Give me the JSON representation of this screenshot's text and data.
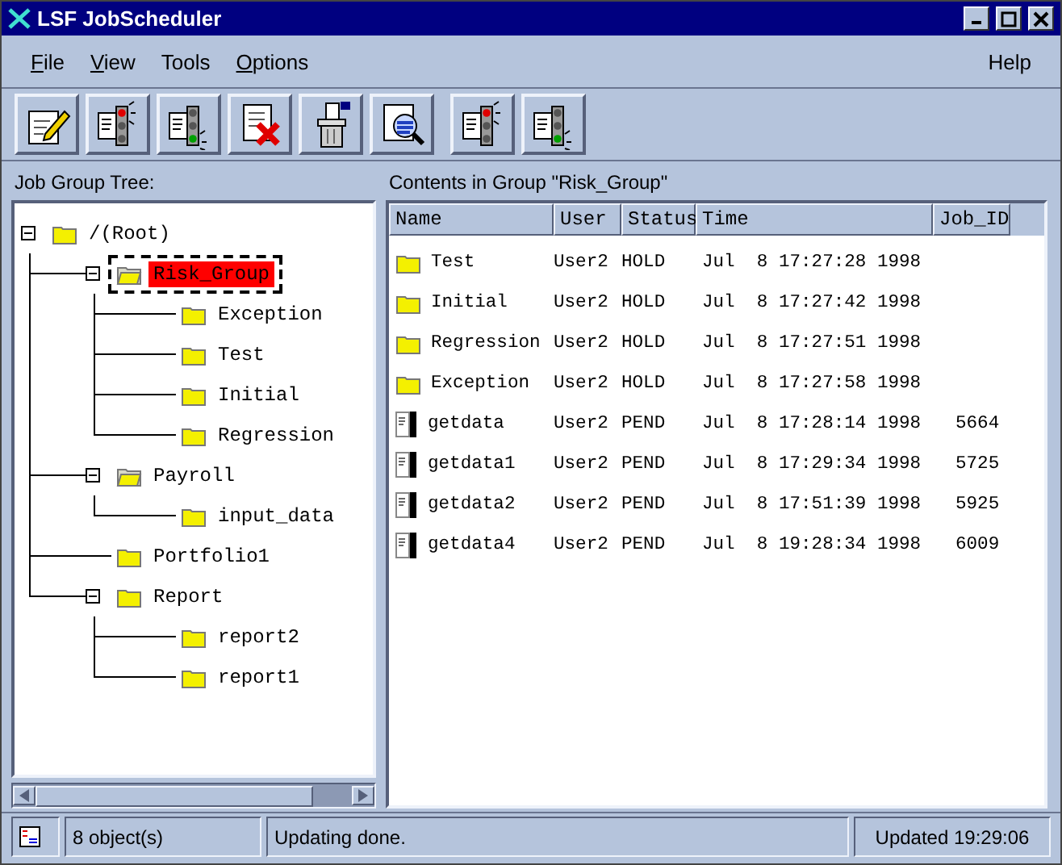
{
  "window": {
    "title": "LSF JobScheduler"
  },
  "menu": [
    {
      "label": "File",
      "underline_first": true
    },
    {
      "label": "View",
      "underline_first": true
    },
    {
      "label": "Tools",
      "underline_first": false
    },
    {
      "label": "Options",
      "underline_first": true
    }
  ],
  "help_menu": {
    "label": "Help",
    "underline_first": false
  },
  "toolbar": [
    {
      "kind": "edit"
    },
    {
      "kind": "stop"
    },
    {
      "kind": "go"
    },
    {
      "kind": "delete"
    },
    {
      "kind": "trash"
    },
    {
      "kind": "inspect"
    },
    {
      "kind": "stop"
    },
    {
      "kind": "go"
    }
  ],
  "tree_panel": {
    "title": "Job Group Tree:",
    "tree": [
      {
        "label": "/(Root)",
        "expanded": true,
        "selected": false,
        "children": [
          {
            "label": "Risk_Group",
            "expanded": true,
            "selected": true,
            "open": true,
            "children": [
              {
                "label": "Exception",
                "selected": false
              },
              {
                "label": "Test",
                "selected": false
              },
              {
                "label": "Initial",
                "selected": false
              },
              {
                "label": "Regression",
                "selected": false
              }
            ]
          },
          {
            "label": "Payroll",
            "expanded": true,
            "selected": false,
            "open": true,
            "children": [
              {
                "label": "input_data",
                "selected": false
              }
            ]
          },
          {
            "label": "Portfolio1",
            "selected": false
          },
          {
            "label": "Report",
            "expanded": true,
            "selected": false,
            "children": [
              {
                "label": "report2",
                "selected": false
              },
              {
                "label": "report1",
                "selected": false
              }
            ]
          }
        ]
      }
    ]
  },
  "contents_panel": {
    "title": "Contents in Group \"Risk_Group\"",
    "columns": [
      "Name",
      "User",
      "Status",
      "Time",
      "Job_ID"
    ],
    "rows": [
      {
        "kind": "group",
        "name": "Test",
        "user": "User2",
        "status": "HOLD",
        "time": "Jul  8 17:27:28 1998"
      },
      {
        "kind": "group",
        "name": "Initial",
        "user": "User2",
        "status": "HOLD",
        "time": "Jul  8 17:27:42 1998"
      },
      {
        "kind": "group",
        "name": "Regression",
        "user": "User2",
        "status": "HOLD",
        "time": "Jul  8 17:27:51 1998"
      },
      {
        "kind": "group",
        "name": "Exception",
        "user": "User2",
        "status": "HOLD",
        "time": "Jul  8 17:27:58 1998"
      },
      {
        "kind": "job",
        "name": "getdata",
        "user": "User2",
        "status": "PEND",
        "time": "Jul  8 17:28:14 1998",
        "job_id": "5664"
      },
      {
        "kind": "job",
        "name": "getdata1",
        "user": "User2",
        "status": "PEND",
        "time": "Jul  8 17:29:34 1998",
        "job_id": "5725"
      },
      {
        "kind": "job",
        "name": "getdata2",
        "user": "User2",
        "status": "PEND",
        "time": "Jul  8 17:51:39 1998",
        "job_id": "5925"
      },
      {
        "kind": "job",
        "name": "getdata4",
        "user": "User2",
        "status": "PEND",
        "time": "Jul  8 19:28:34 1998",
        "job_id": "6009"
      }
    ]
  },
  "status_bar": {
    "count": "8 object(s)",
    "message": "Updating done.",
    "updated": "Updated 19:29:06"
  }
}
